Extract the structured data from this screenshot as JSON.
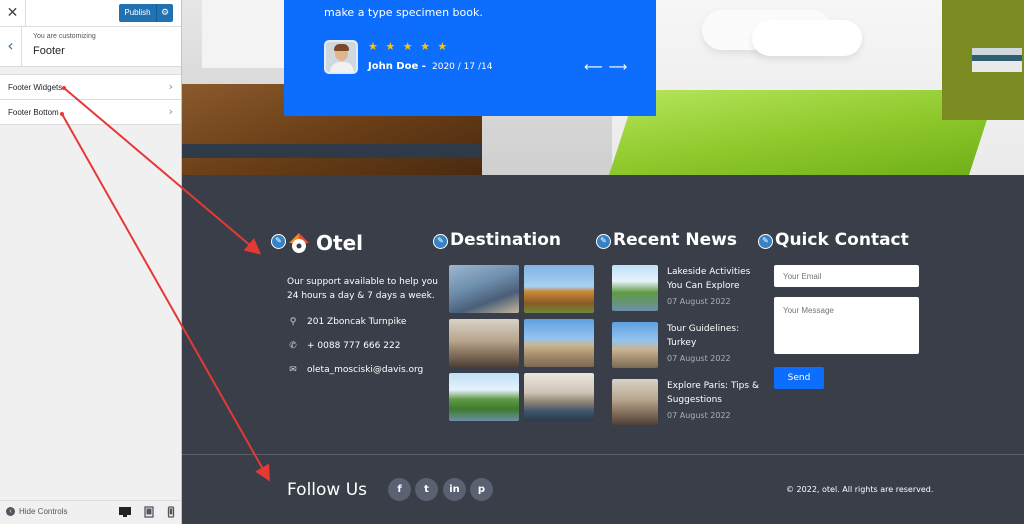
{
  "customizer": {
    "close_icon": "close-icon",
    "publish_label": "Publish",
    "gear_icon": "gear-icon",
    "back_icon": "chevron-left-icon",
    "you_are_customizing": "You are customizing",
    "section_title": "Footer",
    "items": [
      {
        "label": "Footer Widgets"
      },
      {
        "label": "Footer Bottom"
      }
    ],
    "hide_controls_label": "Hide Controls",
    "devices": [
      "desktop",
      "tablet",
      "mobile"
    ],
    "accent": "#2271b1"
  },
  "testimonial": {
    "text": "make a type specimen book.",
    "stars": "★ ★ ★ ★ ★",
    "author": "John Doe -",
    "date": "2020 / 17 /14",
    "arrows": "⟵⟶",
    "bg_color": "#0d6efd"
  },
  "footer": {
    "logo": {
      "text": "Otel"
    },
    "about": {
      "text": "Our support available to help you 24 hours a day & 7 days a week.",
      "address": "201 Zboncak Turnpike",
      "phone": "+ 0088 777 666 222",
      "email": "oleta_mosciski@davis.org"
    },
    "destination": {
      "title": "Destination",
      "images": [
        "hotel-room",
        "temple",
        "tourists-street",
        "venice-square",
        "lake-walkers",
        "venice-gondola"
      ]
    },
    "recent_news": {
      "title": "Recent News",
      "items": [
        {
          "title": "Lakeside Activities You Can Explore",
          "date": "07 August 2022"
        },
        {
          "title": "Tour Guidelines: Turkey",
          "date": "07 August 2022"
        },
        {
          "title": "Explore Paris: Tips & Suggestions",
          "date": "07 August 2022"
        }
      ]
    },
    "quick_contact": {
      "title": "Quick Contact",
      "email_placeholder": "Your Email",
      "message_placeholder": "Your Message",
      "send_label": "Send"
    },
    "follow_us": "Follow Us",
    "social": [
      {
        "name": "facebook-icon",
        "glyph": "f"
      },
      {
        "name": "twitter-icon",
        "glyph": "t"
      },
      {
        "name": "linkedin-icon",
        "glyph": "in"
      },
      {
        "name": "pinterest-icon",
        "glyph": "p"
      }
    ],
    "copyright": "© 2022, otel. All rights are reserved.",
    "bg_color": "#393e48"
  }
}
